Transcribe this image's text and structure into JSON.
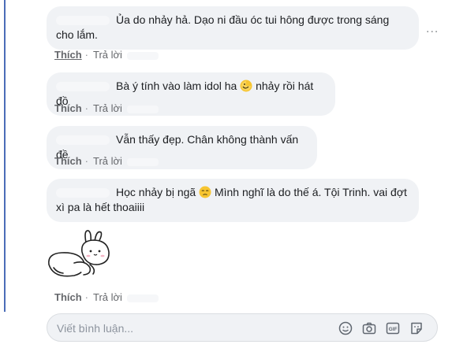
{
  "comments": [
    {
      "text": "Ủa do nhảy hả. Dạo ni đầu óc tui hông được trong sáng cho lắm.",
      "like": "Thích",
      "reply": "Trả lời"
    },
    {
      "text_before": "Bà ý tính vào làm idol ha",
      "emoji": "laughing-moon-emoji",
      "text_after": "nhảy rồi hát đồ",
      "like": "Thích",
      "reply": "Trả lời"
    },
    {
      "text": "Vẫn thấy đẹp. Chân không thành vấn đề",
      "like": "Thích",
      "reply": "Trả lời"
    },
    {
      "text_before": "Học nhảy bị ngã",
      "emoji": "pensive-face-emoji",
      "text_after": "Mình nghĩ là do thế á. Tội Trinh. vai đợt xì pa là hết thoaiiii",
      "like": "Thích",
      "reply": "Trả lời"
    },
    {
      "sticker": "rabbit-sticker",
      "like": "Thích",
      "reply": "Trả lời"
    }
  ],
  "more_options": "...",
  "composer": {
    "placeholder": "Viết bình luận...",
    "icons": [
      "smiley-icon",
      "camera-icon",
      "gif-icon",
      "sticker-icon"
    ]
  },
  "colors": {
    "bubble": "#f0f2f5",
    "text": "#1c1e21",
    "meta": "#65676b",
    "accent_rule": "#4b6db8"
  }
}
